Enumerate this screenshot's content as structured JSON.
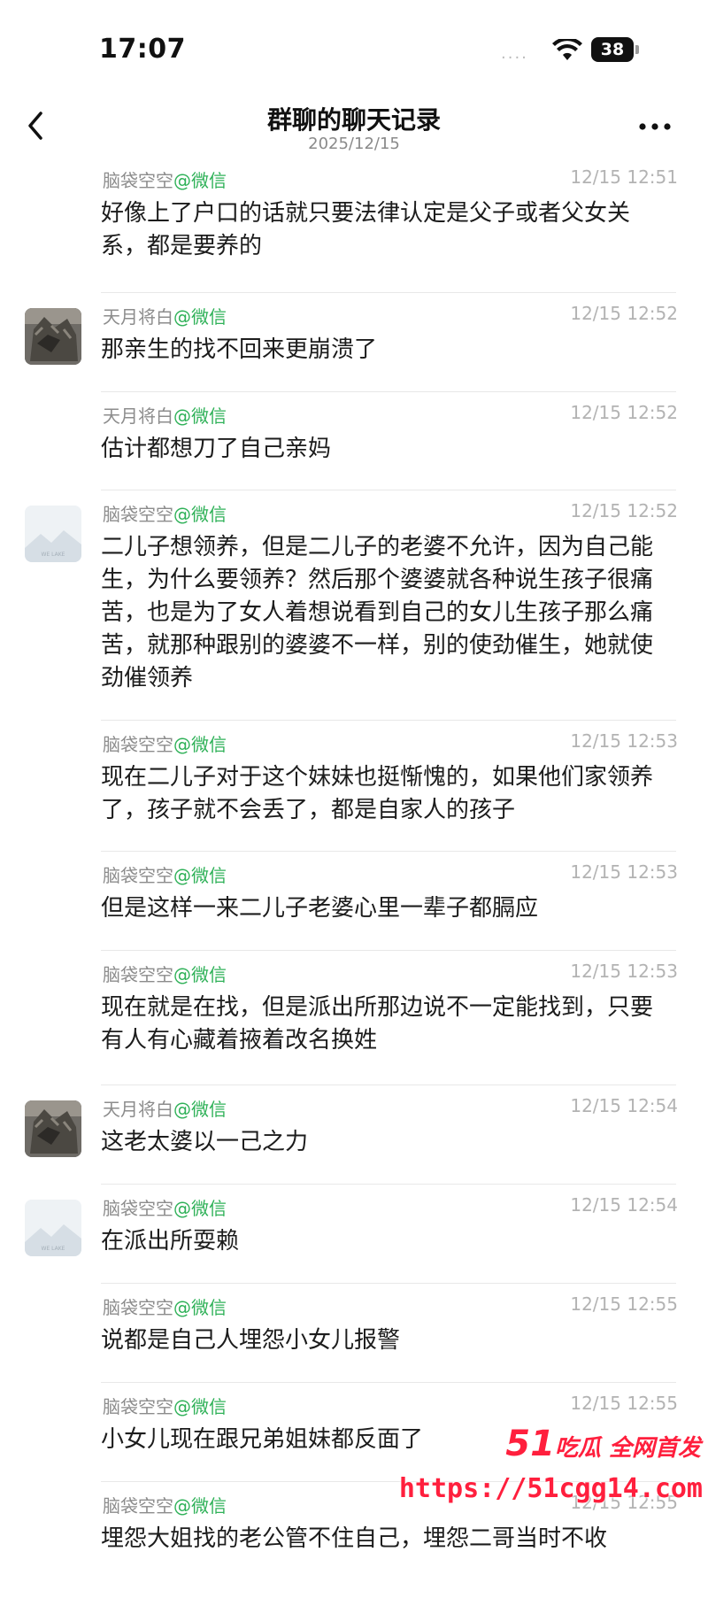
{
  "status_bar": {
    "time": "17:07",
    "battery": "38",
    "signal": "....",
    "battery_color": "#111111"
  },
  "nav": {
    "title": "群聊的聊天记录",
    "date": "2025/12/15",
    "back_icon": "chevron-left-icon",
    "more_icon": "ellipsis-icon",
    "more_label": "•••"
  },
  "colors": {
    "source_green": "#2fb158",
    "timestamp_gray": "#b3b3b3",
    "sender_gray": "#8c8c8c",
    "watermark_red": "#ff1f3d"
  },
  "messages": [
    {
      "sender": "脑袋空空",
      "source": "@微信",
      "time": "12/15 12:51",
      "text": "好像上了户口的话就只要法律认定是父子或者父女关系，都是要养的",
      "avatar": "none"
    },
    {
      "sender": "天月将白",
      "source": "@微信",
      "time": "12/15 12:52",
      "text": "那亲生的找不回来更崩溃了",
      "avatar": "cat"
    },
    {
      "sender": "天月将白",
      "source": "@微信",
      "time": "12/15 12:52",
      "text": "估计都想刀了自己亲妈",
      "avatar": "none"
    },
    {
      "sender": "脑袋空空",
      "source": "@微信",
      "time": "12/15 12:52",
      "text": "二儿子想领养，但是二儿子的老婆不允许，因为自己能生，为什么要领养？然后那个婆婆就各种说生孩子很痛苦，也是为了女人着想说看到自己的女儿生孩子那么痛苦，就那种跟别的婆婆不一样，别的使劲催生，她就使劲催领养",
      "avatar": "placeholder"
    },
    {
      "sender": "脑袋空空",
      "source": "@微信",
      "time": "12/15 12:53",
      "text": "现在二儿子对于这个妹妹也挺惭愧的，如果他们家领养了，孩子就不会丢了，都是自家人的孩子",
      "avatar": "none"
    },
    {
      "sender": "脑袋空空",
      "source": "@微信",
      "time": "12/15 12:53",
      "text": "但是这样一来二儿子老婆心里一辈子都膈应",
      "avatar": "none"
    },
    {
      "sender": "脑袋空空",
      "source": "@微信",
      "time": "12/15 12:53",
      "text": "现在就是在找，但是派出所那边说不一定能找到，只要有人有心藏着掖着改名换姓",
      "avatar": "none"
    },
    {
      "sender": "天月将白",
      "source": "@微信",
      "time": "12/15 12:54",
      "text": "这老太婆以一己之力",
      "avatar": "cat"
    },
    {
      "sender": "脑袋空空",
      "source": "@微信",
      "time": "12/15 12:54",
      "text": "在派出所耍赖",
      "avatar": "placeholder"
    },
    {
      "sender": "脑袋空空",
      "source": "@微信",
      "time": "12/15 12:55",
      "text": "说都是自己人埋怨小女儿报警",
      "avatar": "none"
    },
    {
      "sender": "脑袋空空",
      "source": "@微信",
      "time": "12/15 12:55",
      "text": "小女儿现在跟兄弟姐妹都反面了",
      "avatar": "none"
    },
    {
      "sender": "脑袋空空",
      "source": "@微信",
      "time": "12/15 12:55",
      "text": "埋怨大姐找的老公管不住自己，埋怨二哥当时不收",
      "avatar": "none"
    }
  ],
  "placeholder_avatar_text": "WE LAKE",
  "watermark": {
    "brand": "51",
    "slogan": "吃瓜 全网首发",
    "url": "https://51cgg14.com"
  }
}
